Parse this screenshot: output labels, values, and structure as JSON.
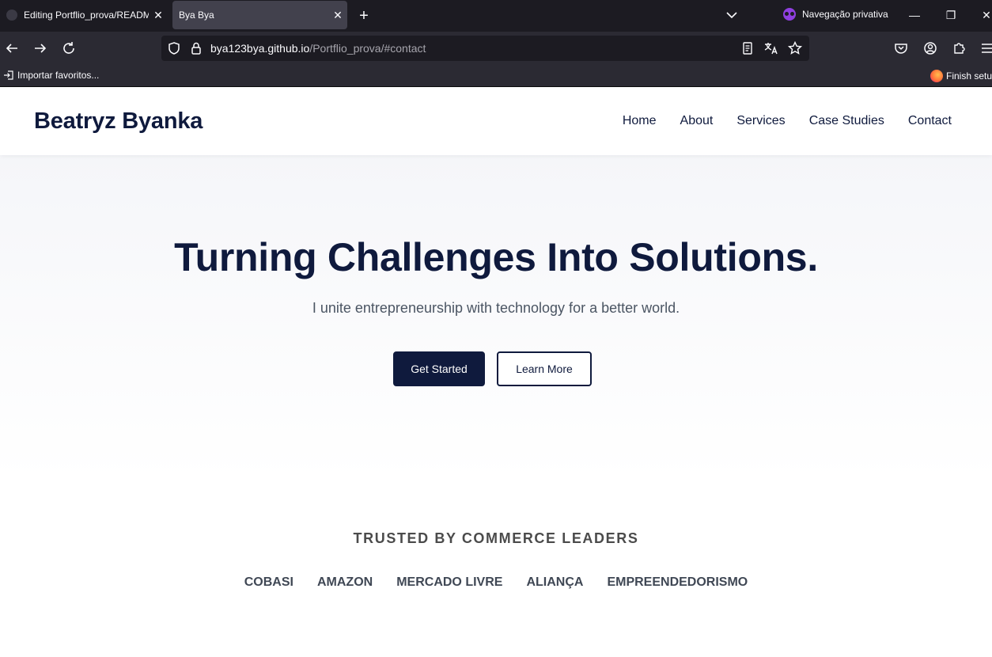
{
  "browser": {
    "tabs": [
      {
        "title": "Editing Portflio_prova/README.md",
        "active": false
      },
      {
        "title": "Bya Bya",
        "active": true
      }
    ],
    "private_label": "Navegação privativa",
    "url": {
      "host": "bya123bya.github.io",
      "path": "/Portflio_prova/#contact"
    },
    "bookmarks": {
      "import_label": "Importar favoritos...",
      "finish_label": "Finish setup"
    }
  },
  "site": {
    "brand": "Beatryz Byanka",
    "nav": [
      "Home",
      "About",
      "Services",
      "Case Studies",
      "Contact"
    ],
    "hero": {
      "title": "Turning Challenges Into Solutions.",
      "subtitle": "I unite entrepreneurship with technology for a better world.",
      "primary_cta": "Get Started",
      "secondary_cta": "Learn More"
    },
    "trusted": {
      "heading": "TRUSTED BY COMMERCE LEADERS",
      "logos": [
        "COBASI",
        "AMAZON",
        "MERCADO LIVRE",
        "ALIANÇA",
        "EMPREENDEDORISMO"
      ]
    },
    "colors": {
      "navy": "#0f1a3d",
      "text_muted": "#4b5563"
    }
  },
  "icons": [
    "back-arrow-icon",
    "forward-arrow-icon",
    "reload-icon",
    "shield-icon",
    "lock-icon",
    "reader-view-icon",
    "translate-icon",
    "star-icon",
    "pocket-icon",
    "account-icon",
    "extensions-icon",
    "menu-icon",
    "import-icon",
    "firefox-icon",
    "private-mask-icon"
  ]
}
